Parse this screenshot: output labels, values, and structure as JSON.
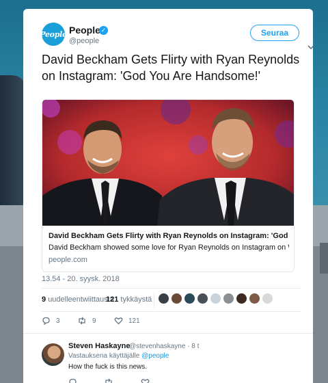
{
  "tweet": {
    "avatar_text": "People",
    "author_name": "People",
    "author_handle": "@people",
    "follow_label": "Seuraa",
    "text": "David Beckham Gets Flirty with Ryan Reynolds on Instagram: 'God You Are Handsome!'",
    "link_card": {
      "title": "David Beckham Gets Flirty with Ryan Reynolds on Instagram: 'God You Ar…",
      "description": "David Beckham showed some love for Ryan Reynolds on Instagram on Wednesday",
      "domain": "people.com"
    },
    "timestamp": "13.54 - 20. syysk. 2018",
    "retweets_count": "9",
    "retweets_label": "uudelleentwiittausta",
    "likes_count": "121",
    "likes_label": "tykkäystä",
    "actions": {
      "replies": "3",
      "retweets": "9",
      "likes": "121"
    }
  },
  "reply": {
    "author_name": "Steven Haskayne",
    "author_handle": "@stevenhaskayne · 8 t",
    "replying_to_label": "Vastauksena käyttäjälle",
    "replying_to_handle": "@people",
    "text": "How the fuck is this news."
  },
  "colors": {
    "accent": "#1da1f2",
    "text": "#14171a",
    "muted": "#657786"
  }
}
